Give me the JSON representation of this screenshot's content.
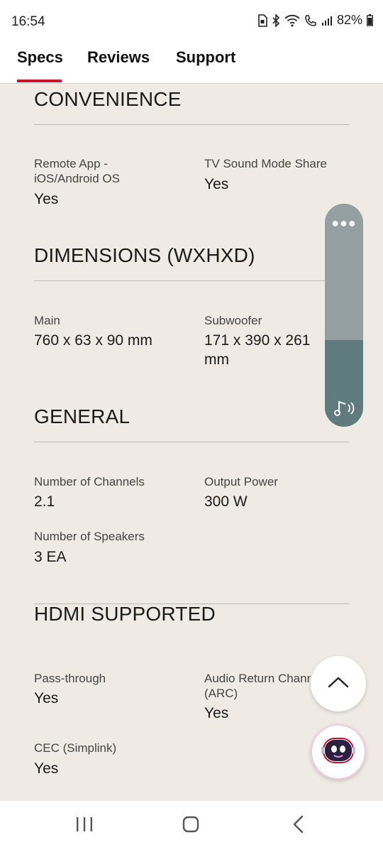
{
  "status": {
    "time": "16:54",
    "battery": "82%",
    "icons": [
      "sim-card-icon",
      "bluetooth-icon",
      "wifi-icon",
      "call-icon",
      "signal-icon",
      "battery-icon"
    ]
  },
  "tabs": [
    {
      "label": "Specs",
      "active": true
    },
    {
      "label": "Reviews",
      "active": false
    },
    {
      "label": "Support",
      "active": false
    }
  ],
  "accent_color": "#c8102e",
  "sections": {
    "convenience": {
      "title": "CONVENIENCE",
      "specs": [
        {
          "label": "Remote App -\niOS/Android OS",
          "value": "Yes"
        },
        {
          "label": "TV Sound Mode Share",
          "value": "Yes"
        }
      ]
    },
    "dimensions": {
      "title": "DIMENSIONS (WXHXD)",
      "specs": [
        {
          "label": "Main",
          "value": "760 x 63 x 90 mm"
        },
        {
          "label": "Subwoofer",
          "value": "171 x 390 x 261\nmm"
        }
      ]
    },
    "general": {
      "title": "GENERAL",
      "specs": [
        {
          "label": "Number of Channels",
          "value": "2.1"
        },
        {
          "label": "Output Power",
          "value": "300 W"
        },
        {
          "label": "Number of Speakers",
          "value": "3 EA"
        }
      ]
    },
    "hdmi": {
      "title": "HDMI SUPPORTED",
      "specs": [
        {
          "label": "Pass-through",
          "value": "Yes"
        },
        {
          "label": "Audio Return Channel\n(ARC)",
          "value": "Yes"
        },
        {
          "label": "CEC (Simplink)",
          "value": "Yes"
        }
      ]
    }
  },
  "floating": {
    "sound_widget_icons": [
      "more-icon",
      "sound-assistant-icon"
    ],
    "scroll_top_icon": "chevron-up-icon",
    "chatbot_icon": "chatbot-icon"
  },
  "navbar": [
    "recents-icon",
    "home-icon",
    "back-icon"
  ]
}
